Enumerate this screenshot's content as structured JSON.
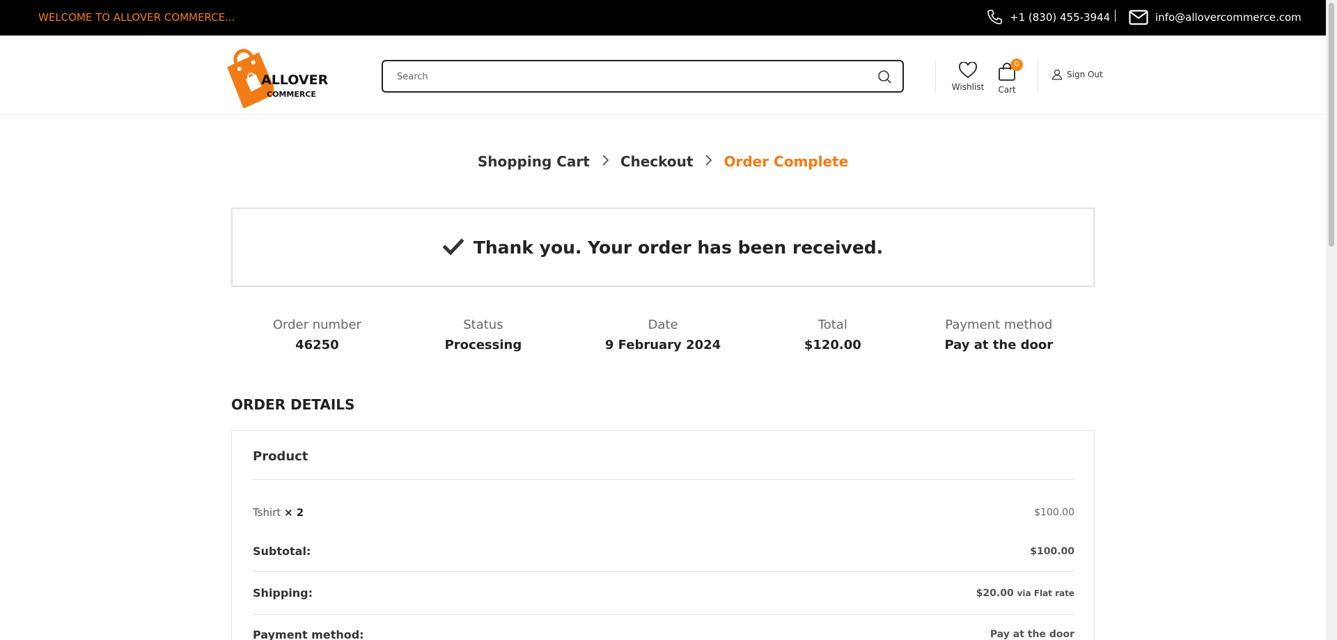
{
  "topbar": {
    "welcome": "WELCOME TO ALLOVER COMMERCE...",
    "phone": "+1 (830) 455-3944",
    "email": "info@allovercommerce.com"
  },
  "header": {
    "logo": {
      "line1": "ALLOVER",
      "line2": "COMMERCE"
    },
    "search_placeholder": "Search",
    "wishlist_label": "Wishlist",
    "cart_label": "Cart",
    "cart_count": "0",
    "signout_label": "Sign Out"
  },
  "steps": {
    "cart": "Shopping Cart",
    "checkout": "Checkout",
    "complete": "Order Complete"
  },
  "thanks": "Thank you. Your order has been received.",
  "overview": {
    "order_number": {
      "label": "Order number",
      "value": "46250"
    },
    "status": {
      "label": "Status",
      "value": "Processing"
    },
    "date": {
      "label": "Date",
      "value": "9 February 2024"
    },
    "total": {
      "label": "Total",
      "value": "$120.00"
    },
    "payment": {
      "label": "Payment method",
      "value": "Pay at the door"
    }
  },
  "order_details": {
    "title": "ORDER DETAILS",
    "column_product": "Product",
    "item": {
      "name": "Tshirt",
      "qty": "× 2",
      "price": "$100.00"
    },
    "subtotal": {
      "label": "Subtotal:",
      "value": "$100.00"
    },
    "shipping": {
      "label": "Shipping:",
      "value": "$20.00",
      "via": "via Flat rate"
    },
    "payment": {
      "label": "Payment method:",
      "value": "Pay at the door"
    }
  },
  "colors": {
    "accent": "#f27b16",
    "topbar_bg": "#000000"
  }
}
